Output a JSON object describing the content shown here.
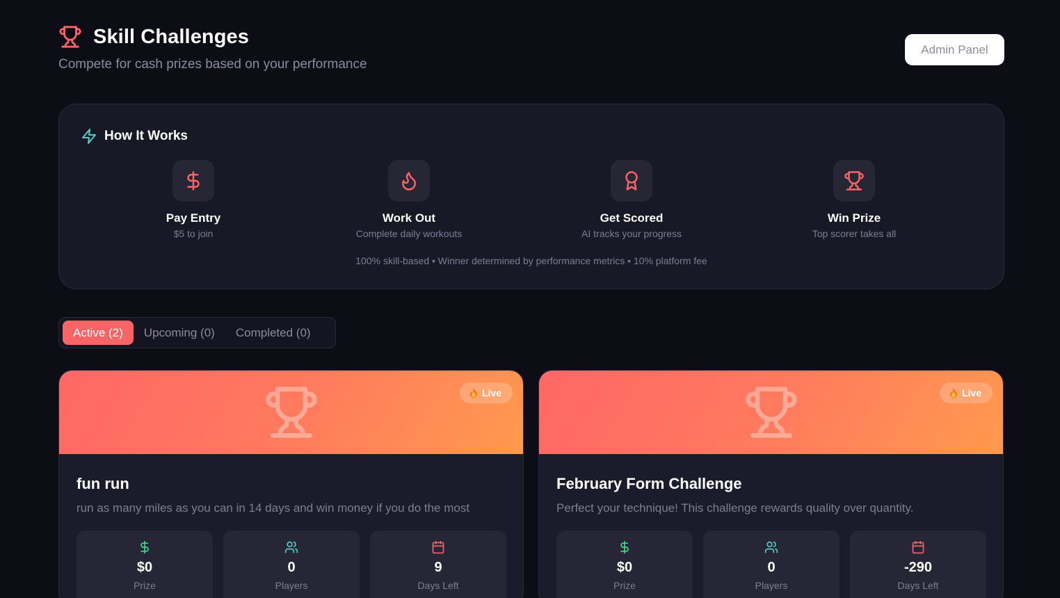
{
  "header": {
    "title": "Skill Challenges",
    "subtitle": "Compete for cash prizes based on your performance",
    "title_icon": "trophy-icon",
    "admin_button": "Admin Panel"
  },
  "how_it_works": {
    "title": "How It Works",
    "icon": "zap-icon",
    "steps": [
      {
        "icon": "dollar-icon",
        "title": "Pay Entry",
        "desc": "$5 to join"
      },
      {
        "icon": "flame-icon",
        "title": "Work Out",
        "desc": "Complete daily workouts"
      },
      {
        "icon": "award-icon",
        "title": "Get Scored",
        "desc": "AI tracks your progress"
      },
      {
        "icon": "trophy-icon",
        "title": "Win Prize",
        "desc": "Top scorer takes all"
      }
    ],
    "footer": "100% skill-based • Winner determined by performance metrics • 10% platform fee"
  },
  "tabs": [
    {
      "label": "Active (2)",
      "active": true
    },
    {
      "label": "Upcoming (0)",
      "active": false
    },
    {
      "label": "Completed (0)",
      "active": false
    }
  ],
  "challenges": [
    {
      "badge": "Live",
      "title": "fun run",
      "description": "run as many miles as you can in 14 days and win money if you do the most",
      "stats": [
        {
          "icon": "dollar-icon",
          "value": "$0",
          "label": "Prize"
        },
        {
          "icon": "users-icon",
          "value": "0",
          "label": "Players"
        },
        {
          "icon": "calendar-icon",
          "value": "9",
          "label": "Days Left"
        }
      ]
    },
    {
      "badge": "Live",
      "title": "February Form Challenge",
      "description": "Perfect your technique! This challenge rewards quality over quantity.",
      "stats": [
        {
          "icon": "dollar-icon",
          "value": "$0",
          "label": "Prize"
        },
        {
          "icon": "users-icon",
          "value": "0",
          "label": "Players"
        },
        {
          "icon": "calendar-icon",
          "value": "-290",
          "label": "Days Left"
        }
      ]
    }
  ],
  "colors": {
    "background": "#0d0d16",
    "accent": "#f96466",
    "teal": "#4fd1c5",
    "green": "#3ddc84",
    "muted": "#7c7f92"
  }
}
